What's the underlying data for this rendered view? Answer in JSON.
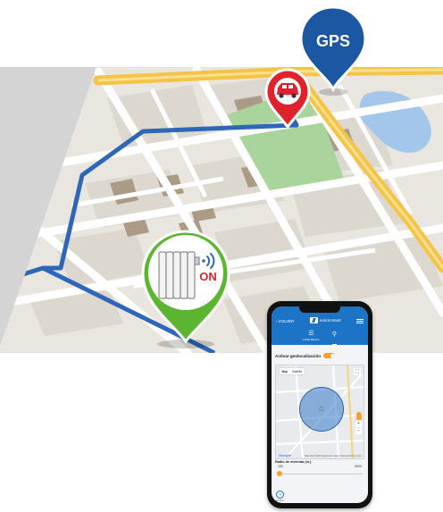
{
  "pins": {
    "gps_label": "GPS",
    "heater_status": "ON"
  },
  "app": {
    "back_label": "VOLVER",
    "brand_name": "noirot.smart",
    "tabs": [
      {
        "label": "LISTA DE ALL",
        "icon": "list-icon"
      },
      {
        "label": "",
        "icon": "location-icon"
      }
    ],
    "geolocation_label": "Activar geolocalización",
    "geolocation_enabled": true,
    "map": {
      "map_type_options": [
        "Map",
        "Satellite"
      ],
      "selected_map_type": "Map",
      "google_label": "Google",
      "attribution": "Map data ©2020 Google Inst. Geogr. Nacional  Terms of Use",
      "home_icon": "home-icon"
    },
    "radius_label": "Radio de vivienda (m.)",
    "radius_min": "150",
    "radius_max": "5000",
    "radius_fraction": 0.0,
    "help_label": "AYUDA"
  },
  "colors": {
    "gps_pin": "#1b57a3",
    "car_pin": "#e0222d",
    "heater_pin": "#5cb531",
    "route": "#2e67b8",
    "app_header": "#1d74c7",
    "accent_orange": "#f4a324",
    "on_text": "#e0222d"
  }
}
